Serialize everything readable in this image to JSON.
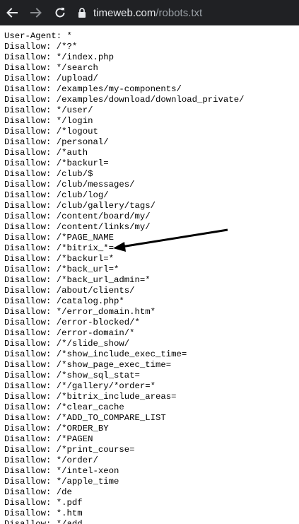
{
  "browser": {
    "url_host": "timeweb.com",
    "url_path": "/robots.txt",
    "back_icon": "arrow-left-icon",
    "forward_icon": "arrow-right-icon",
    "reload_icon": "reload-icon",
    "lock_icon": "lock-icon"
  },
  "robots": {
    "lines": [
      "User-Agent: *",
      "Disallow: /*?*",
      "Disallow: */index.php",
      "Disallow: */search",
      "Disallow: /upload/",
      "Disallow: /examples/my-components/",
      "Disallow: /examples/download/download_private/",
      "Disallow: */user/",
      "Disallow: */login",
      "Disallow: /*logout",
      "Disallow: /personal/",
      "Disallow: /*auth",
      "Disallow: /*backurl=",
      "Disallow: /club/$",
      "Disallow: /club/messages/",
      "Disallow: /club/log/",
      "Disallow: /club/gallery/tags/",
      "Disallow: /content/board/my/",
      "Disallow: /content/links/my/",
      "Disallow: /*PAGE_NAME",
      "Disallow: /*bitrix_*=",
      "Disallow: /*backurl=*",
      "Disallow: /*back_url=*",
      "Disallow: /*back_url_admin=*",
      "Disallow: /about/clients/",
      "Disallow: /catalog.php*",
      "Disallow: */error_domain.htm*",
      "Disallow: /error-blocked/*",
      "Disallow: /error-domain/*",
      "Disallow: /*/slide_show/",
      "Disallow: /*show_include_exec_time=",
      "Disallow: /*show_page_exec_time=",
      "Disallow: /*show_sql_stat=",
      "Disallow: /*/gallery/*order=*",
      "Disallow: /*bitrix_include_areas=",
      "Disallow: /*clear_cache",
      "Disallow: /*ADD_TO_COMPARE_LIST",
      "Disallow: /*ORDER_BY",
      "Disallow: /*PAGEN",
      "Disallow: /*print_course=",
      "Disallow: */order/",
      "Disallow: */intel-xeon",
      "Disallow: */apple_time",
      "Disallow: /de",
      "Disallow: *.pdf",
      "Disallow: *.htm",
      "Disallow: */add"
    ]
  },
  "colors": {
    "toolbar_bg": "#202124",
    "url_host": "#e8eaed",
    "url_path": "#9aa0a6",
    "page_bg": "#ffffff",
    "text": "#000000",
    "annotation_arrow": "#000000"
  }
}
